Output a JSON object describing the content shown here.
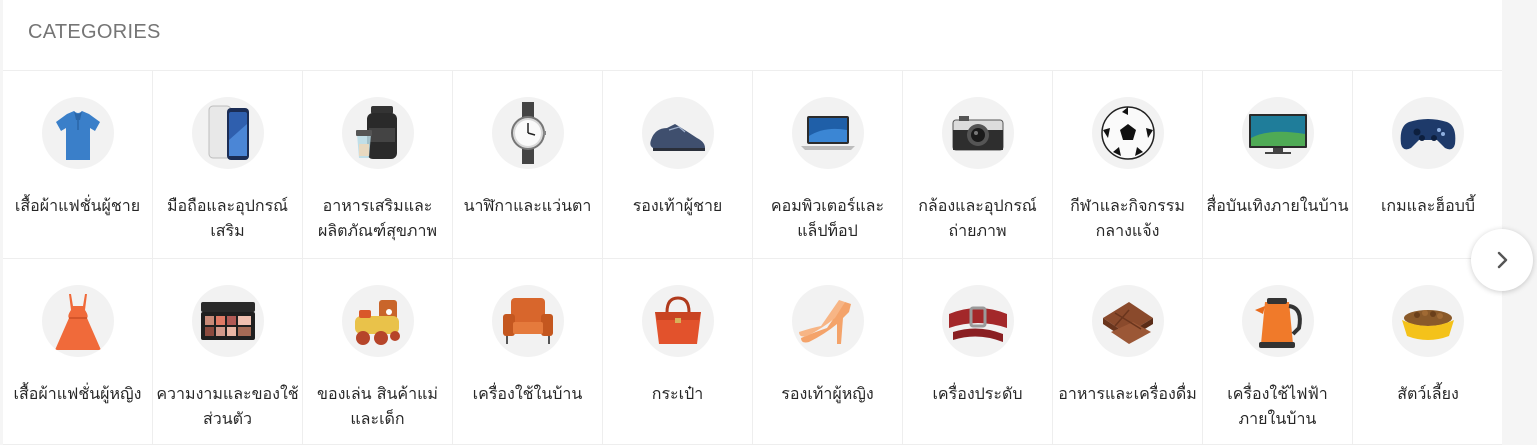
{
  "header": {
    "title": "CATEGORIES"
  },
  "categories": [
    {
      "label": "เสื้อผ้าแฟชั่นผู้ชาย",
      "icon": "men-shirt-icon"
    },
    {
      "label": "มือถือและอุปกรณ์เสริม",
      "icon": "smartphone-icon"
    },
    {
      "label": "อาหารเสริมและผลิตภัณฑ์สุขภาพ",
      "icon": "supplement-jar-icon"
    },
    {
      "label": "นาฬิกาและแว่นตา",
      "icon": "wristwatch-icon"
    },
    {
      "label": "รองเท้าผู้ชาย",
      "icon": "men-shoe-icon"
    },
    {
      "label": "คอมพิวเตอร์และแล็ปท็อป",
      "icon": "laptop-icon"
    },
    {
      "label": "กล้องและอุปกรณ์ถ่ายภาพ",
      "icon": "camera-icon"
    },
    {
      "label": "กีฬาและกิจกรรมกลางแจ้ง",
      "icon": "soccer-ball-icon"
    },
    {
      "label": "สื่อบันเทิงภายในบ้าน",
      "icon": "television-icon"
    },
    {
      "label": "เกมและฮ็อบบี้",
      "icon": "gamepad-icon"
    },
    {
      "label": "เสื้อผ้าแฟชั่นผู้หญิง",
      "icon": "women-dress-icon"
    },
    {
      "label": "ความงามและของใช้ส่วนตัว",
      "icon": "makeup-palette-icon"
    },
    {
      "label": "ของเล่น สินค้าแม่และเด็ก",
      "icon": "toy-train-icon"
    },
    {
      "label": "เครื่องใช้ในบ้าน",
      "icon": "armchair-icon"
    },
    {
      "label": "กระเป๋า",
      "icon": "handbag-icon"
    },
    {
      "label": "รองเท้าผู้หญิง",
      "icon": "high-heel-icon"
    },
    {
      "label": "เครื่องประดับ",
      "icon": "belt-icon"
    },
    {
      "label": "อาหารและเครื่องดื่ม",
      "icon": "chocolate-icon"
    },
    {
      "label": "เครื่องใช้ไฟฟ้าภายในบ้าน",
      "icon": "electric-kettle-icon"
    },
    {
      "label": "สัตว์เลี้ยง",
      "icon": "pet-bowl-icon"
    }
  ],
  "next_button": {
    "icon": "chevron-right-icon"
  }
}
